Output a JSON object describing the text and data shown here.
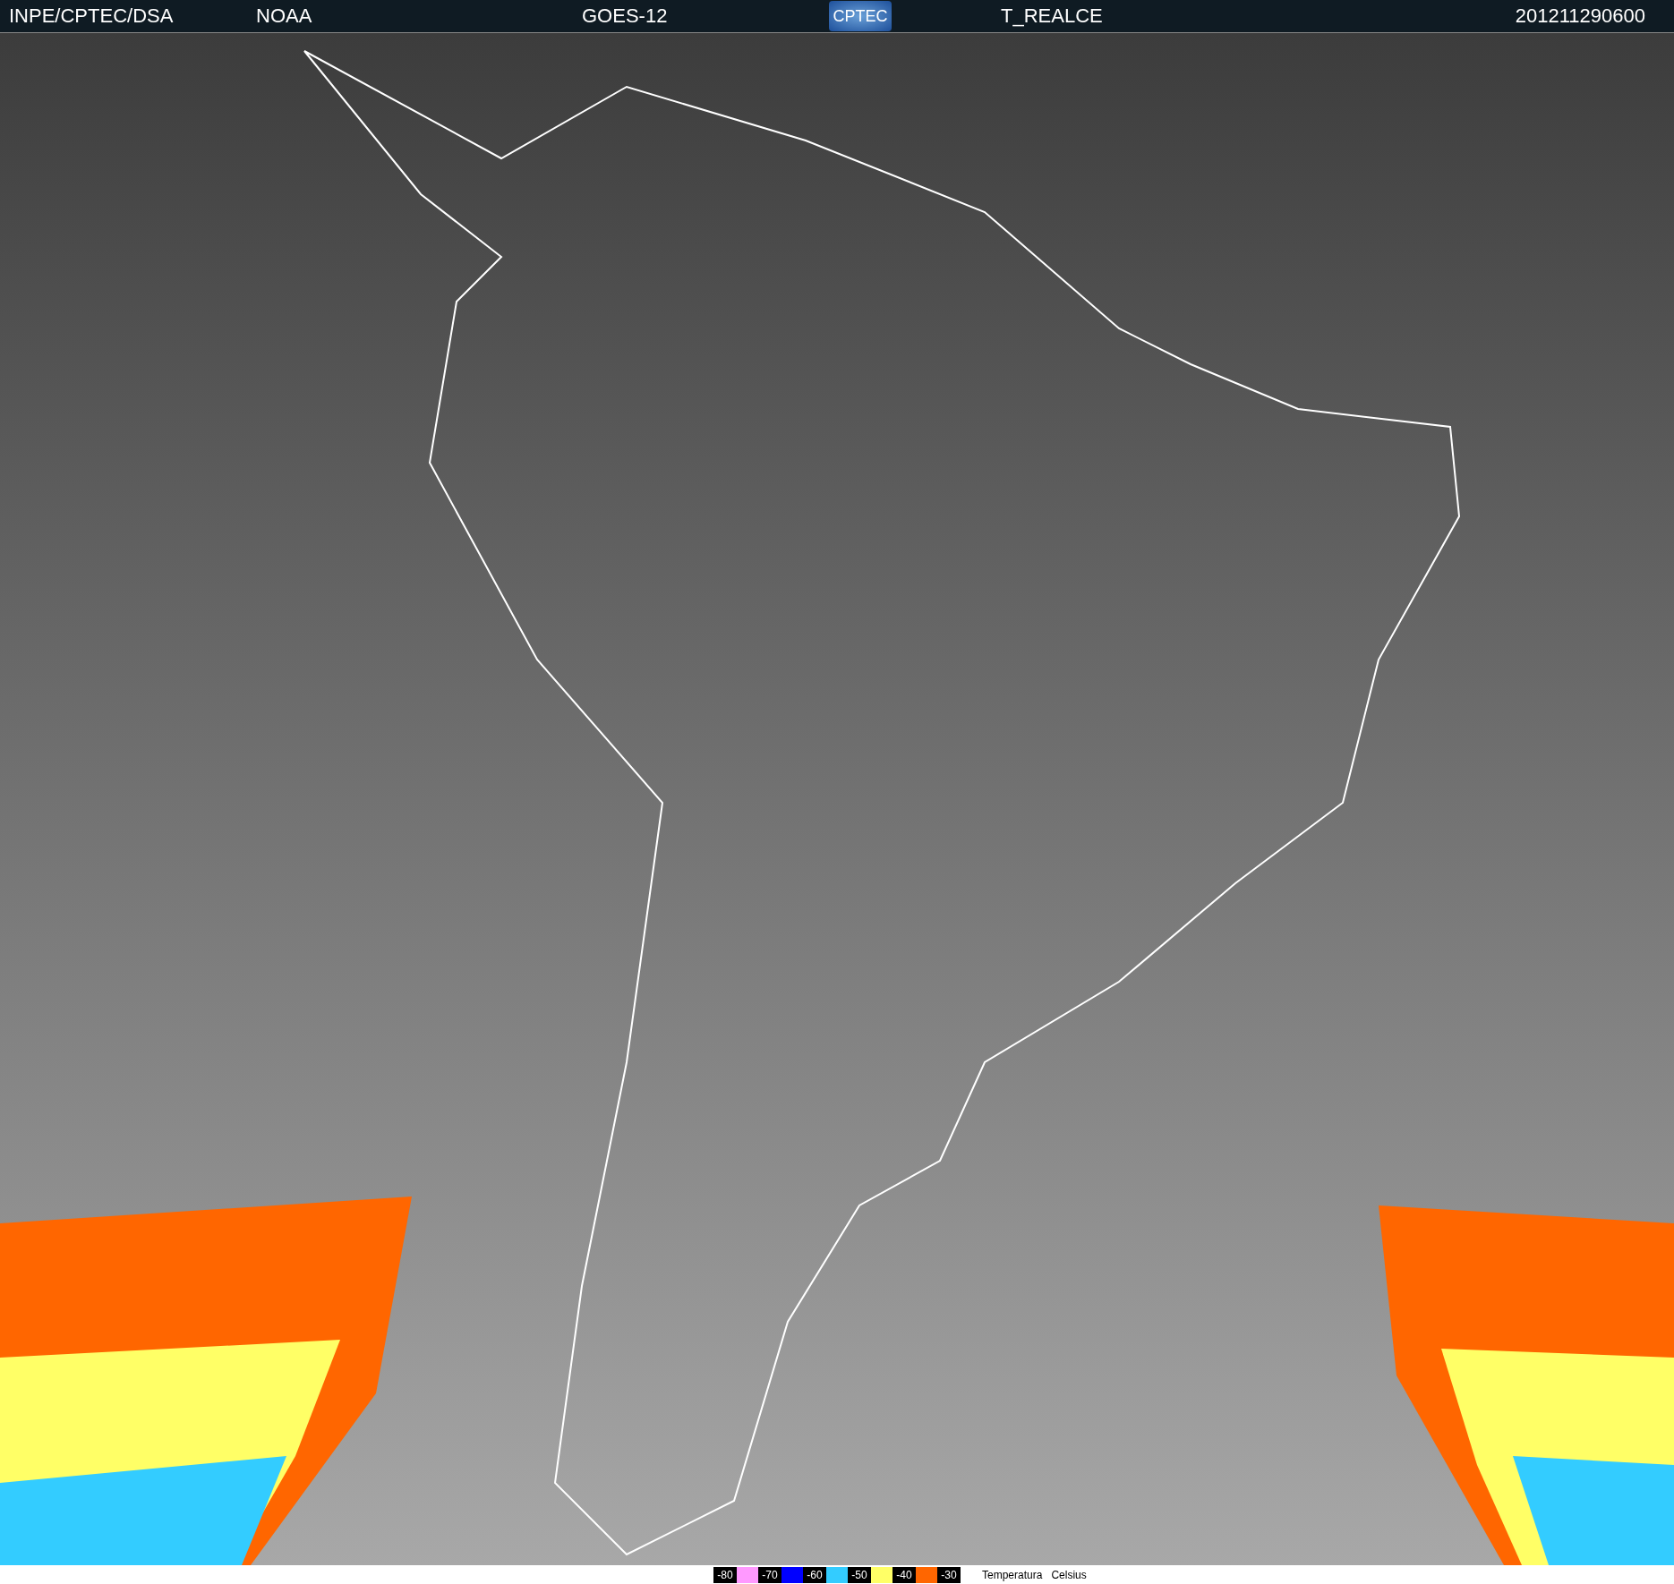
{
  "header": {
    "agency": "INPE/CPTEC/DSA",
    "source": "NOAA",
    "satellite": "GOES-12",
    "logo": "CPTEC",
    "product": "T_REALCE",
    "timestamp": "201211290600"
  },
  "legend": {
    "items": [
      {
        "kind": "label",
        "text": "-80"
      },
      {
        "kind": "swatch",
        "color": "#ff99ff"
      },
      {
        "kind": "label",
        "text": "-70"
      },
      {
        "kind": "swatch",
        "color": "#0000ff"
      },
      {
        "kind": "label",
        "text": "-60"
      },
      {
        "kind": "swatch",
        "color": "#33ccff"
      },
      {
        "kind": "label",
        "text": "-50"
      },
      {
        "kind": "swatch",
        "color": "#ffff66"
      },
      {
        "kind": "label",
        "text": "-40"
      },
      {
        "kind": "swatch",
        "color": "#ff6600"
      },
      {
        "kind": "label",
        "text": "-30"
      }
    ],
    "title": "Temperatura",
    "unit": "Celsius"
  }
}
